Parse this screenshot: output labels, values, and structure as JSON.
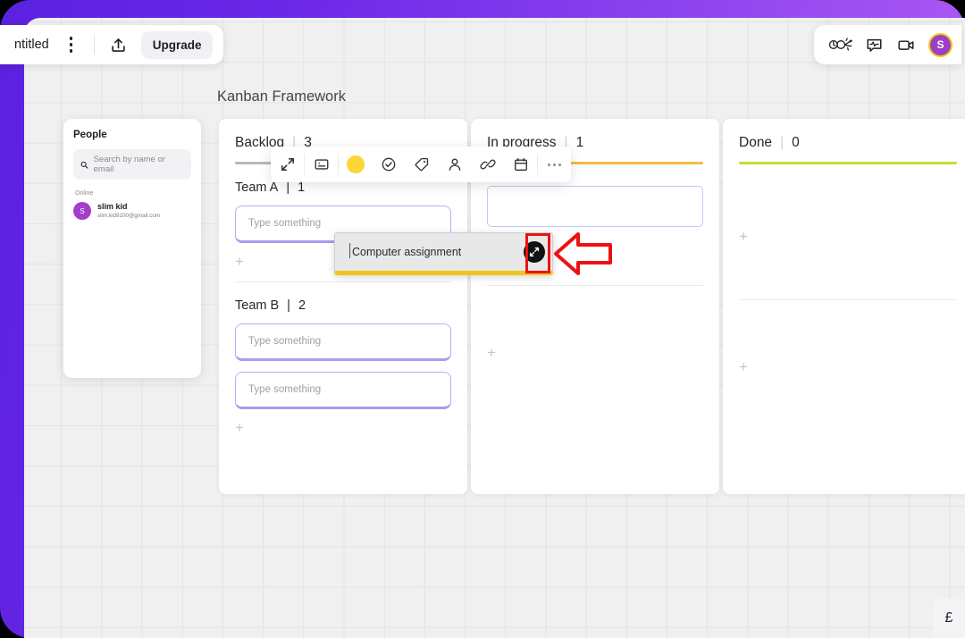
{
  "window": {
    "accent_purple": "#6d28e8",
    "canvas_bg": "#f0f0f0"
  },
  "topbar": {
    "doc_title": "ntitled",
    "kebab_icon": "more-vertical-icon",
    "share_icon": "share-upload-icon",
    "upgrade_label": "Upgrade",
    "reactions_icon": "reactions-doodle-icon",
    "chat_icon": "chat-pulse-icon",
    "video_icon": "video-camera-icon",
    "avatar_initial": "S"
  },
  "board": {
    "title": "Kanban Framework"
  },
  "people": {
    "heading": "People",
    "search_icon": "search-icon",
    "search_placeholder": "Search by name or email",
    "online_label": "Online",
    "members": [
      {
        "initial": "S",
        "name": "slim kid",
        "email": "slim.kid9100@gmail.com"
      }
    ]
  },
  "columns": [
    {
      "name": "Backlog",
      "separator": "|",
      "count": "3",
      "rule_color": "#b8b8bd",
      "sections": [
        {
          "name": "Team A",
          "separator": "|",
          "count": "1",
          "cards": [
            "Type something"
          ],
          "add_label": "+"
        },
        {
          "name": "Team B",
          "separator": "|",
          "count": "2",
          "cards": [
            "Type something",
            "Type something"
          ],
          "add_label": "+"
        }
      ]
    },
    {
      "name": "In progress",
      "separator": "|",
      "count": "1",
      "rule_color": "#f5b945",
      "add_label": "+"
    },
    {
      "name": "Done",
      "separator": "|",
      "count": "0",
      "rule_color": "#c2de3a",
      "add_label": "+"
    }
  ],
  "element_toolbar": {
    "items": [
      {
        "icon": "expand-arrows-icon",
        "label": "Expand"
      },
      {
        "icon": "sticky-note-icon",
        "label": "Note"
      },
      {
        "icon": "color-swatch-yellow-icon",
        "label": "Color",
        "color": "#fcd634"
      },
      {
        "icon": "check-circle-icon",
        "label": "Done"
      },
      {
        "icon": "tag-icon",
        "label": "Tag"
      },
      {
        "icon": "person-icon",
        "label": "Assign"
      },
      {
        "icon": "link-icon",
        "label": "Link"
      },
      {
        "icon": "calendar-icon",
        "label": "Due date"
      },
      {
        "icon": "more-horizontal-icon",
        "label": "More"
      }
    ]
  },
  "dragged_card": {
    "text": "Computer assignment",
    "expand_icon": "expand-arrows-icon",
    "accent_color": "#f0c420"
  },
  "annotation": {
    "highlight_color": "#ee1111",
    "arrow_icon": "left-arrow-annotation"
  },
  "bottom_right": {
    "glyph": "£",
    "icon": "partial-widget-icon"
  }
}
